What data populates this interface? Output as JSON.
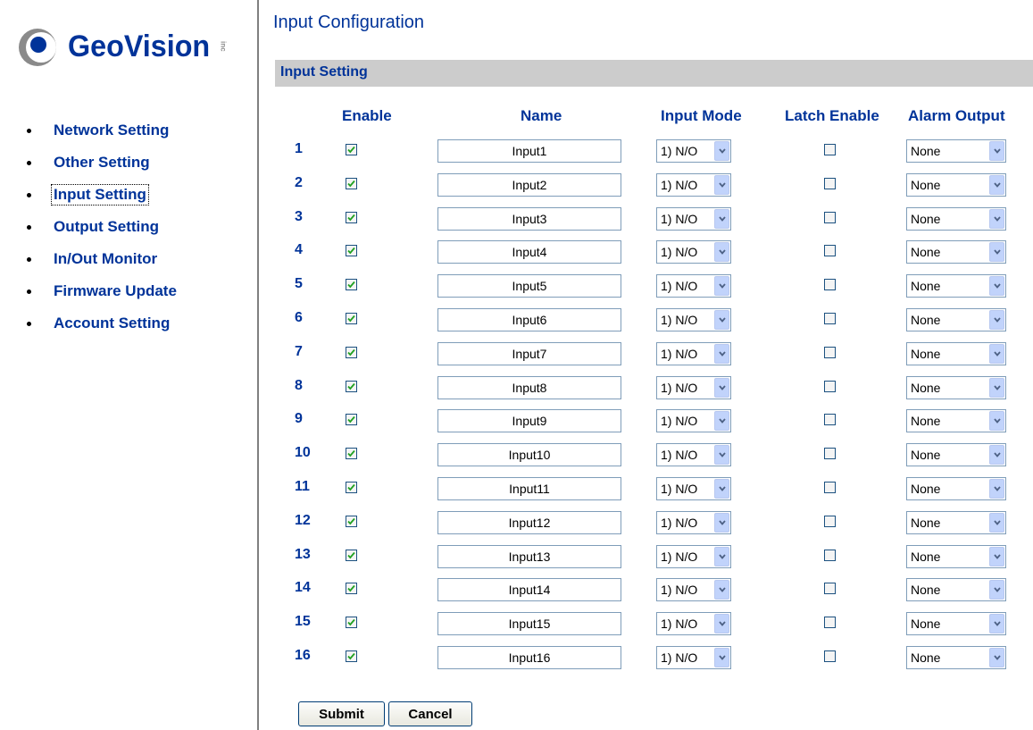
{
  "brand": {
    "name": "GeoVision",
    "suffix": "inc"
  },
  "nav": [
    {
      "label": "Network Setting",
      "active": false
    },
    {
      "label": "Other Setting",
      "active": false
    },
    {
      "label": "Input Setting",
      "active": true
    },
    {
      "label": "Output Setting",
      "active": false
    },
    {
      "label": "In/Out Monitor",
      "active": false
    },
    {
      "label": "Firmware Update",
      "active": false
    },
    {
      "label": "Account Setting",
      "active": false
    }
  ],
  "page": {
    "title": "Input Configuration",
    "section": "Input Setting"
  },
  "columns": {
    "enable": "Enable",
    "name": "Name",
    "input_mode": "Input Mode",
    "latch_enable": "Latch Enable",
    "alarm_output": "Alarm Output"
  },
  "rows": [
    {
      "num": "1",
      "enable": true,
      "name": "Input1",
      "mode": "1) N/O",
      "latch": false,
      "alarm": "None"
    },
    {
      "num": "2",
      "enable": true,
      "name": "Input2",
      "mode": "1) N/O",
      "latch": false,
      "alarm": "None"
    },
    {
      "num": "3",
      "enable": true,
      "name": "Input3",
      "mode": "1) N/O",
      "latch": false,
      "alarm": "None"
    },
    {
      "num": "4",
      "enable": true,
      "name": "Input4",
      "mode": "1) N/O",
      "latch": false,
      "alarm": "None"
    },
    {
      "num": "5",
      "enable": true,
      "name": "Input5",
      "mode": "1) N/O",
      "latch": false,
      "alarm": "None"
    },
    {
      "num": "6",
      "enable": true,
      "name": "Input6",
      "mode": "1) N/O",
      "latch": false,
      "alarm": "None"
    },
    {
      "num": "7",
      "enable": true,
      "name": "Input7",
      "mode": "1) N/O",
      "latch": false,
      "alarm": "None"
    },
    {
      "num": "8",
      "enable": true,
      "name": "Input8",
      "mode": "1) N/O",
      "latch": false,
      "alarm": "None"
    },
    {
      "num": "9",
      "enable": true,
      "name": "Input9",
      "mode": "1) N/O",
      "latch": false,
      "alarm": "None"
    },
    {
      "num": "10",
      "enable": true,
      "name": "Input10",
      "mode": "1) N/O",
      "latch": false,
      "alarm": "None"
    },
    {
      "num": "11",
      "enable": true,
      "name": "Input11",
      "mode": "1) N/O",
      "latch": false,
      "alarm": "None"
    },
    {
      "num": "12",
      "enable": true,
      "name": "Input12",
      "mode": "1) N/O",
      "latch": false,
      "alarm": "None"
    },
    {
      "num": "13",
      "enable": true,
      "name": "Input13",
      "mode": "1) N/O",
      "latch": false,
      "alarm": "None"
    },
    {
      "num": "14",
      "enable": true,
      "name": "Input14",
      "mode": "1) N/O",
      "latch": false,
      "alarm": "None"
    },
    {
      "num": "15",
      "enable": true,
      "name": "Input15",
      "mode": "1) N/O",
      "latch": false,
      "alarm": "None"
    },
    {
      "num": "16",
      "enable": true,
      "name": "Input16",
      "mode": "1) N/O",
      "latch": false,
      "alarm": "None"
    }
  ],
  "buttons": {
    "submit": "Submit",
    "cancel": "Cancel"
  },
  "colors": {
    "brand_blue": "#003399",
    "section_bar": "#cccccc",
    "divider": "#808080",
    "check_green": "#21a121",
    "dropdown_arrow_bg": "#c1d3fb"
  }
}
